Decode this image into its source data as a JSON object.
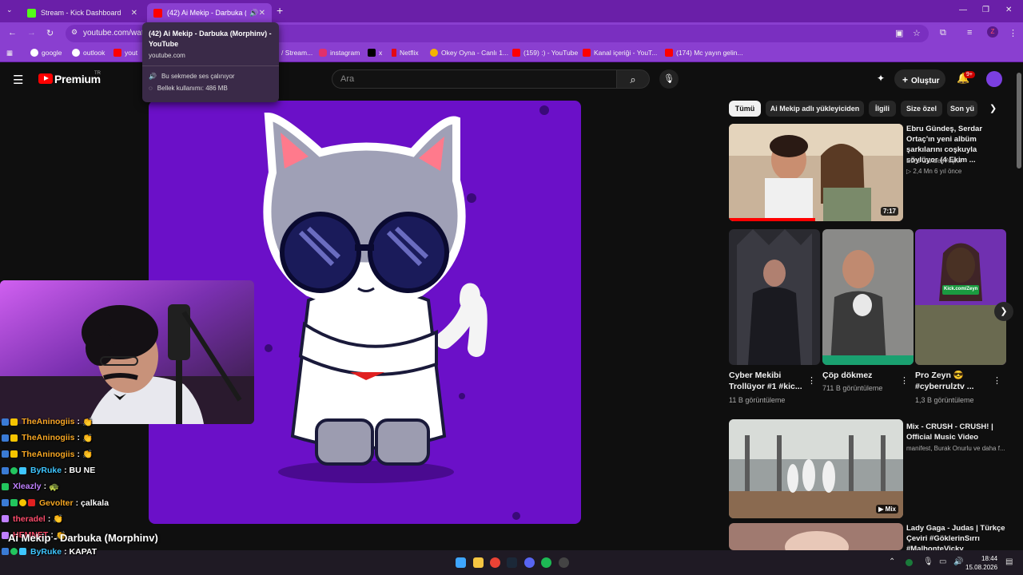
{
  "browser": {
    "tabs": [
      {
        "title": "Stream - Kick Dashboard",
        "active": false,
        "favicon_color": "#53fc18"
      },
      {
        "title": "(42) Ai Mekip - Darbuka (M",
        "active": true,
        "favicon_color": "#ff0000"
      }
    ],
    "url": "youtube.com/wat",
    "bookmarks": [
      {
        "label": "google",
        "color": "#ffffff"
      },
      {
        "label": "outlook",
        "color": "#ffffff"
      },
      {
        "label": "yout",
        "color": "#ff0000"
      },
      {
        "label": "/ Stream...",
        "color": "#8a3fd0"
      },
      {
        "label": "instagram",
        "color": "#e1306c"
      },
      {
        "label": "x",
        "color": "#000000"
      },
      {
        "label": "Netflix",
        "color": "#e50914"
      },
      {
        "label": "Okey Oyna - Canlı 1...",
        "color": "#f5b400"
      },
      {
        "label": "(159) :) - YouTube",
        "color": "#ff0000"
      },
      {
        "label": "Kanal içeriği - YouT...",
        "color": "#ff0000"
      },
      {
        "label": "(174) Mc yayın gelin...",
        "color": "#ff0000"
      }
    ],
    "profile_letter": "Z"
  },
  "hovercard": {
    "title": "(42) Ai Mekip - Darbuka (Morphinv) - YouTube",
    "domain": "youtube.com",
    "audio": "Bu sekmede ses çalınıyor",
    "memory": "Bellek kullanımı: 486 MB"
  },
  "youtube": {
    "logo_text": "Premium",
    "logo_sup": "TR",
    "search_placeholder": "Ara",
    "create_label": "Oluştur",
    "notif_count": "9+",
    "chips": [
      "Tümü",
      "Ai Mekip adlı yükleyiciden",
      "İlgili",
      "Size özel",
      "Son yü"
    ],
    "recommended": [
      {
        "title": "Ebru Gündeş, Serdar Ortaç'ın yeni albüm şarkılarını coşkuyla söylüyor (4 Ekim ...",
        "channel": "Ebru Gündeş Arşivi",
        "meta": "2,4 Mn  6 yıl önce",
        "duration": "7:17"
      },
      {
        "title": "Mix - CRUSH - CRUSH! | Official Music Video",
        "channel": "manifest, Burak Onurlu ve daha f...",
        "meta": "",
        "duration": "Mix"
      },
      {
        "title": "Lady Gaga - Judas | Türkçe Çeviri #GöklerinSırrı #MalhonteVicky",
        "channel": "",
        "meta": "",
        "duration": ""
      }
    ],
    "shorts": [
      {
        "title": "Cyber Mekibi Trollüyor #1 #kic...",
        "views": "11 B görüntüleme"
      },
      {
        "title": "Çöp dökmez",
        "views": "711 B görüntüleme"
      },
      {
        "title": "Pro Zeyn 😎 #cyberrulztv ...",
        "views": "1,3 B görüntüleme"
      }
    ],
    "shorts_overlay_text": "Kick.com/Zeyn"
  },
  "chat": [
    {
      "user": "TheAninogiis",
      "msg": ":",
      "emote": "👏",
      "color": "#f5a623"
    },
    {
      "user": "TheAninogiis",
      "msg": ":",
      "emote": "👏",
      "color": "#f5a623"
    },
    {
      "user": "TheAninogiis",
      "msg": ":",
      "emote": "👏",
      "color": "#f5a623"
    },
    {
      "user": "ByRuke",
      "msg": ": BU NE",
      "emote": "",
      "color": "#3ec6ff"
    },
    {
      "user": "Xleazly",
      "msg": ":",
      "emote": "🐢",
      "color": "#c080ff"
    },
    {
      "user": "Gevolter",
      "msg": ": çalkala",
      "emote": "",
      "color": "#f5a623"
    },
    {
      "user": "theradel",
      "msg": ":",
      "emote": "👏",
      "color": "#ff4d6d"
    },
    {
      "user": "HEMNET",
      "msg": ":",
      "emote": "👏",
      "color": "#ff4d6d"
    },
    {
      "user": "ByRuke",
      "msg": ": KAPAT",
      "emote": "",
      "color": "#3ec6ff"
    }
  ],
  "now_playing": "Ai Mekip - Darbuka (Morphinv)",
  "taskbar": {
    "time": "18:44",
    "date": "15.08.2026"
  },
  "colors": {
    "browser_purple": "#8a3fd0",
    "video_bg": "#6b10c8",
    "yt_red": "#ff0000"
  }
}
